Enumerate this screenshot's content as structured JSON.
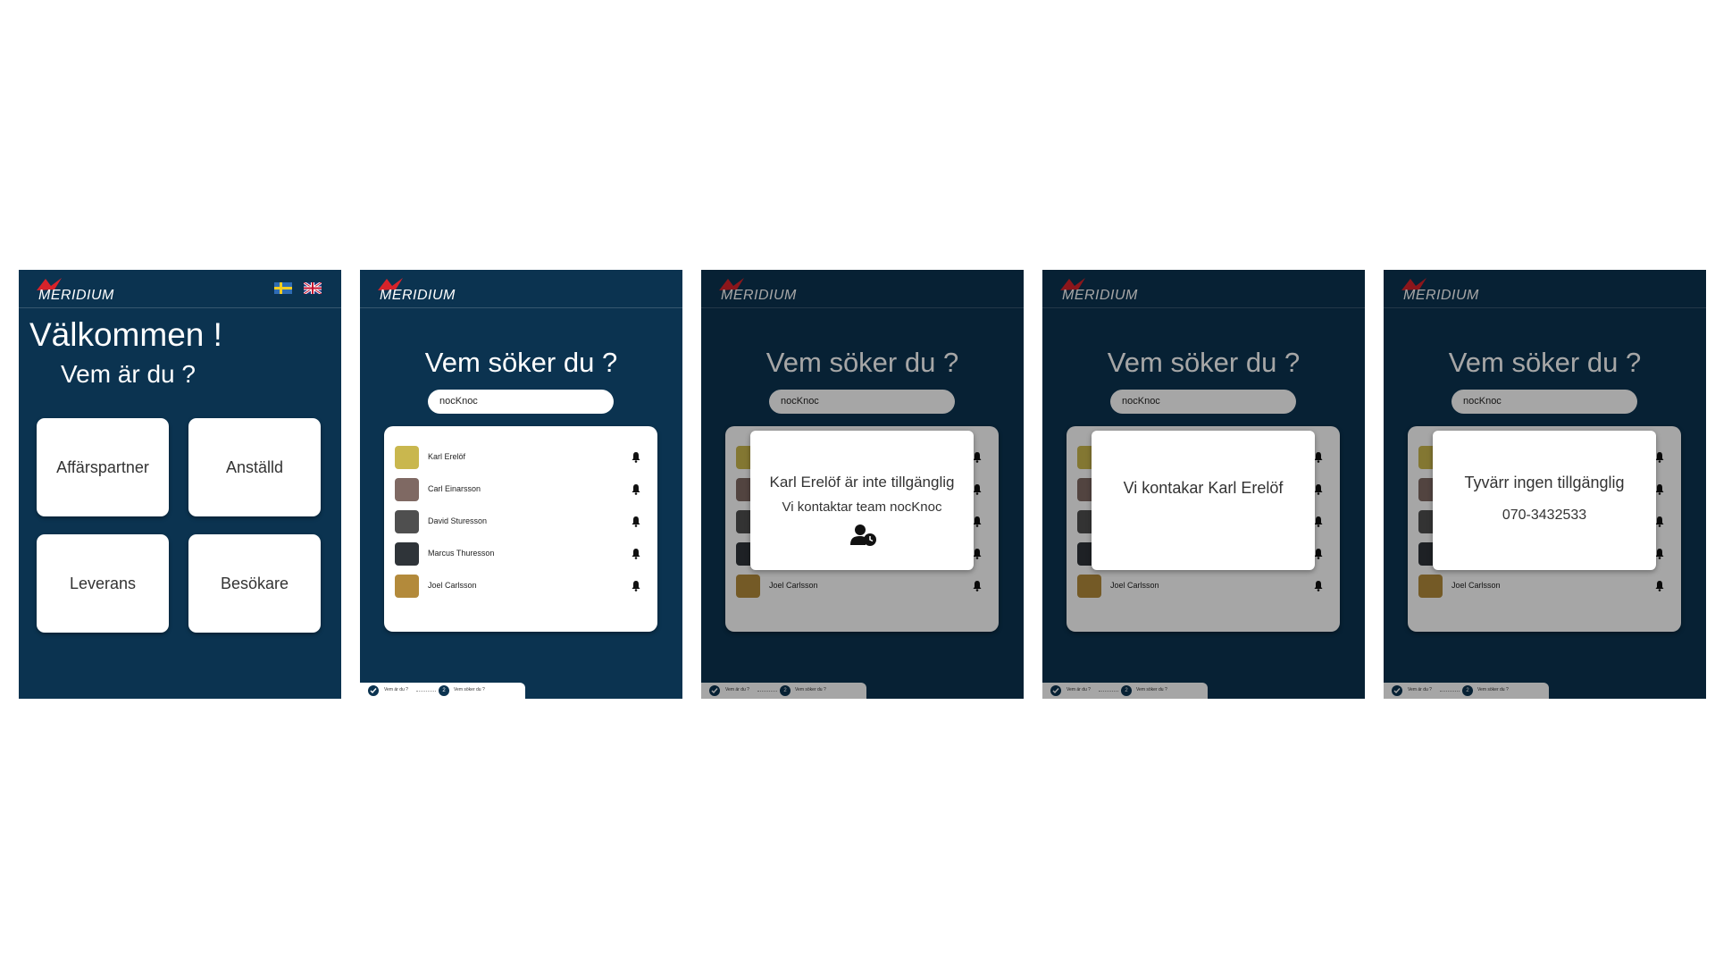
{
  "app": {
    "logo_text": "MERIDIUM"
  },
  "colors": {
    "background": "#0b3350",
    "card": "#ffffff",
    "overlay": "rgba(0,0,0,0.35)"
  },
  "screen1": {
    "welcome": "Välkommen !",
    "question": "Vem är du ?",
    "languages": [
      "swedish-flag-icon",
      "uk-flag-icon"
    ],
    "roles": [
      "Affärspartner",
      "Anställd",
      "Leverans",
      "Besökare"
    ]
  },
  "search_screen": {
    "heading": "Vem söker du ?",
    "search_value": "nocKnoc",
    "people": [
      {
        "name": "Karl Erelöf",
        "icon": "bell-icon"
      },
      {
        "name": "Carl Einarsson",
        "icon": "bell-icon"
      },
      {
        "name": "David Sturesson",
        "icon": "bell-icon"
      },
      {
        "name": "Marcus Thuresson",
        "icon": "bell-icon"
      },
      {
        "name": "Joel Carlsson",
        "icon": "bell-icon"
      }
    ],
    "progress": {
      "step1": "Vem är du ?",
      "step2_number": "2",
      "step2": "Vem söker du ?"
    }
  },
  "modal_unavailable": {
    "title": "Karl Erelöf är inte tillgänglig",
    "subtitle": "Vi kontaktar team nocKnoc",
    "icon": "user-clock-icon"
  },
  "modal_contacting": {
    "title": "Vi kontakar Karl Erelöf"
  },
  "modal_none": {
    "title": "Tyvärr ingen tillgänglig",
    "phone": "070-3432533"
  }
}
